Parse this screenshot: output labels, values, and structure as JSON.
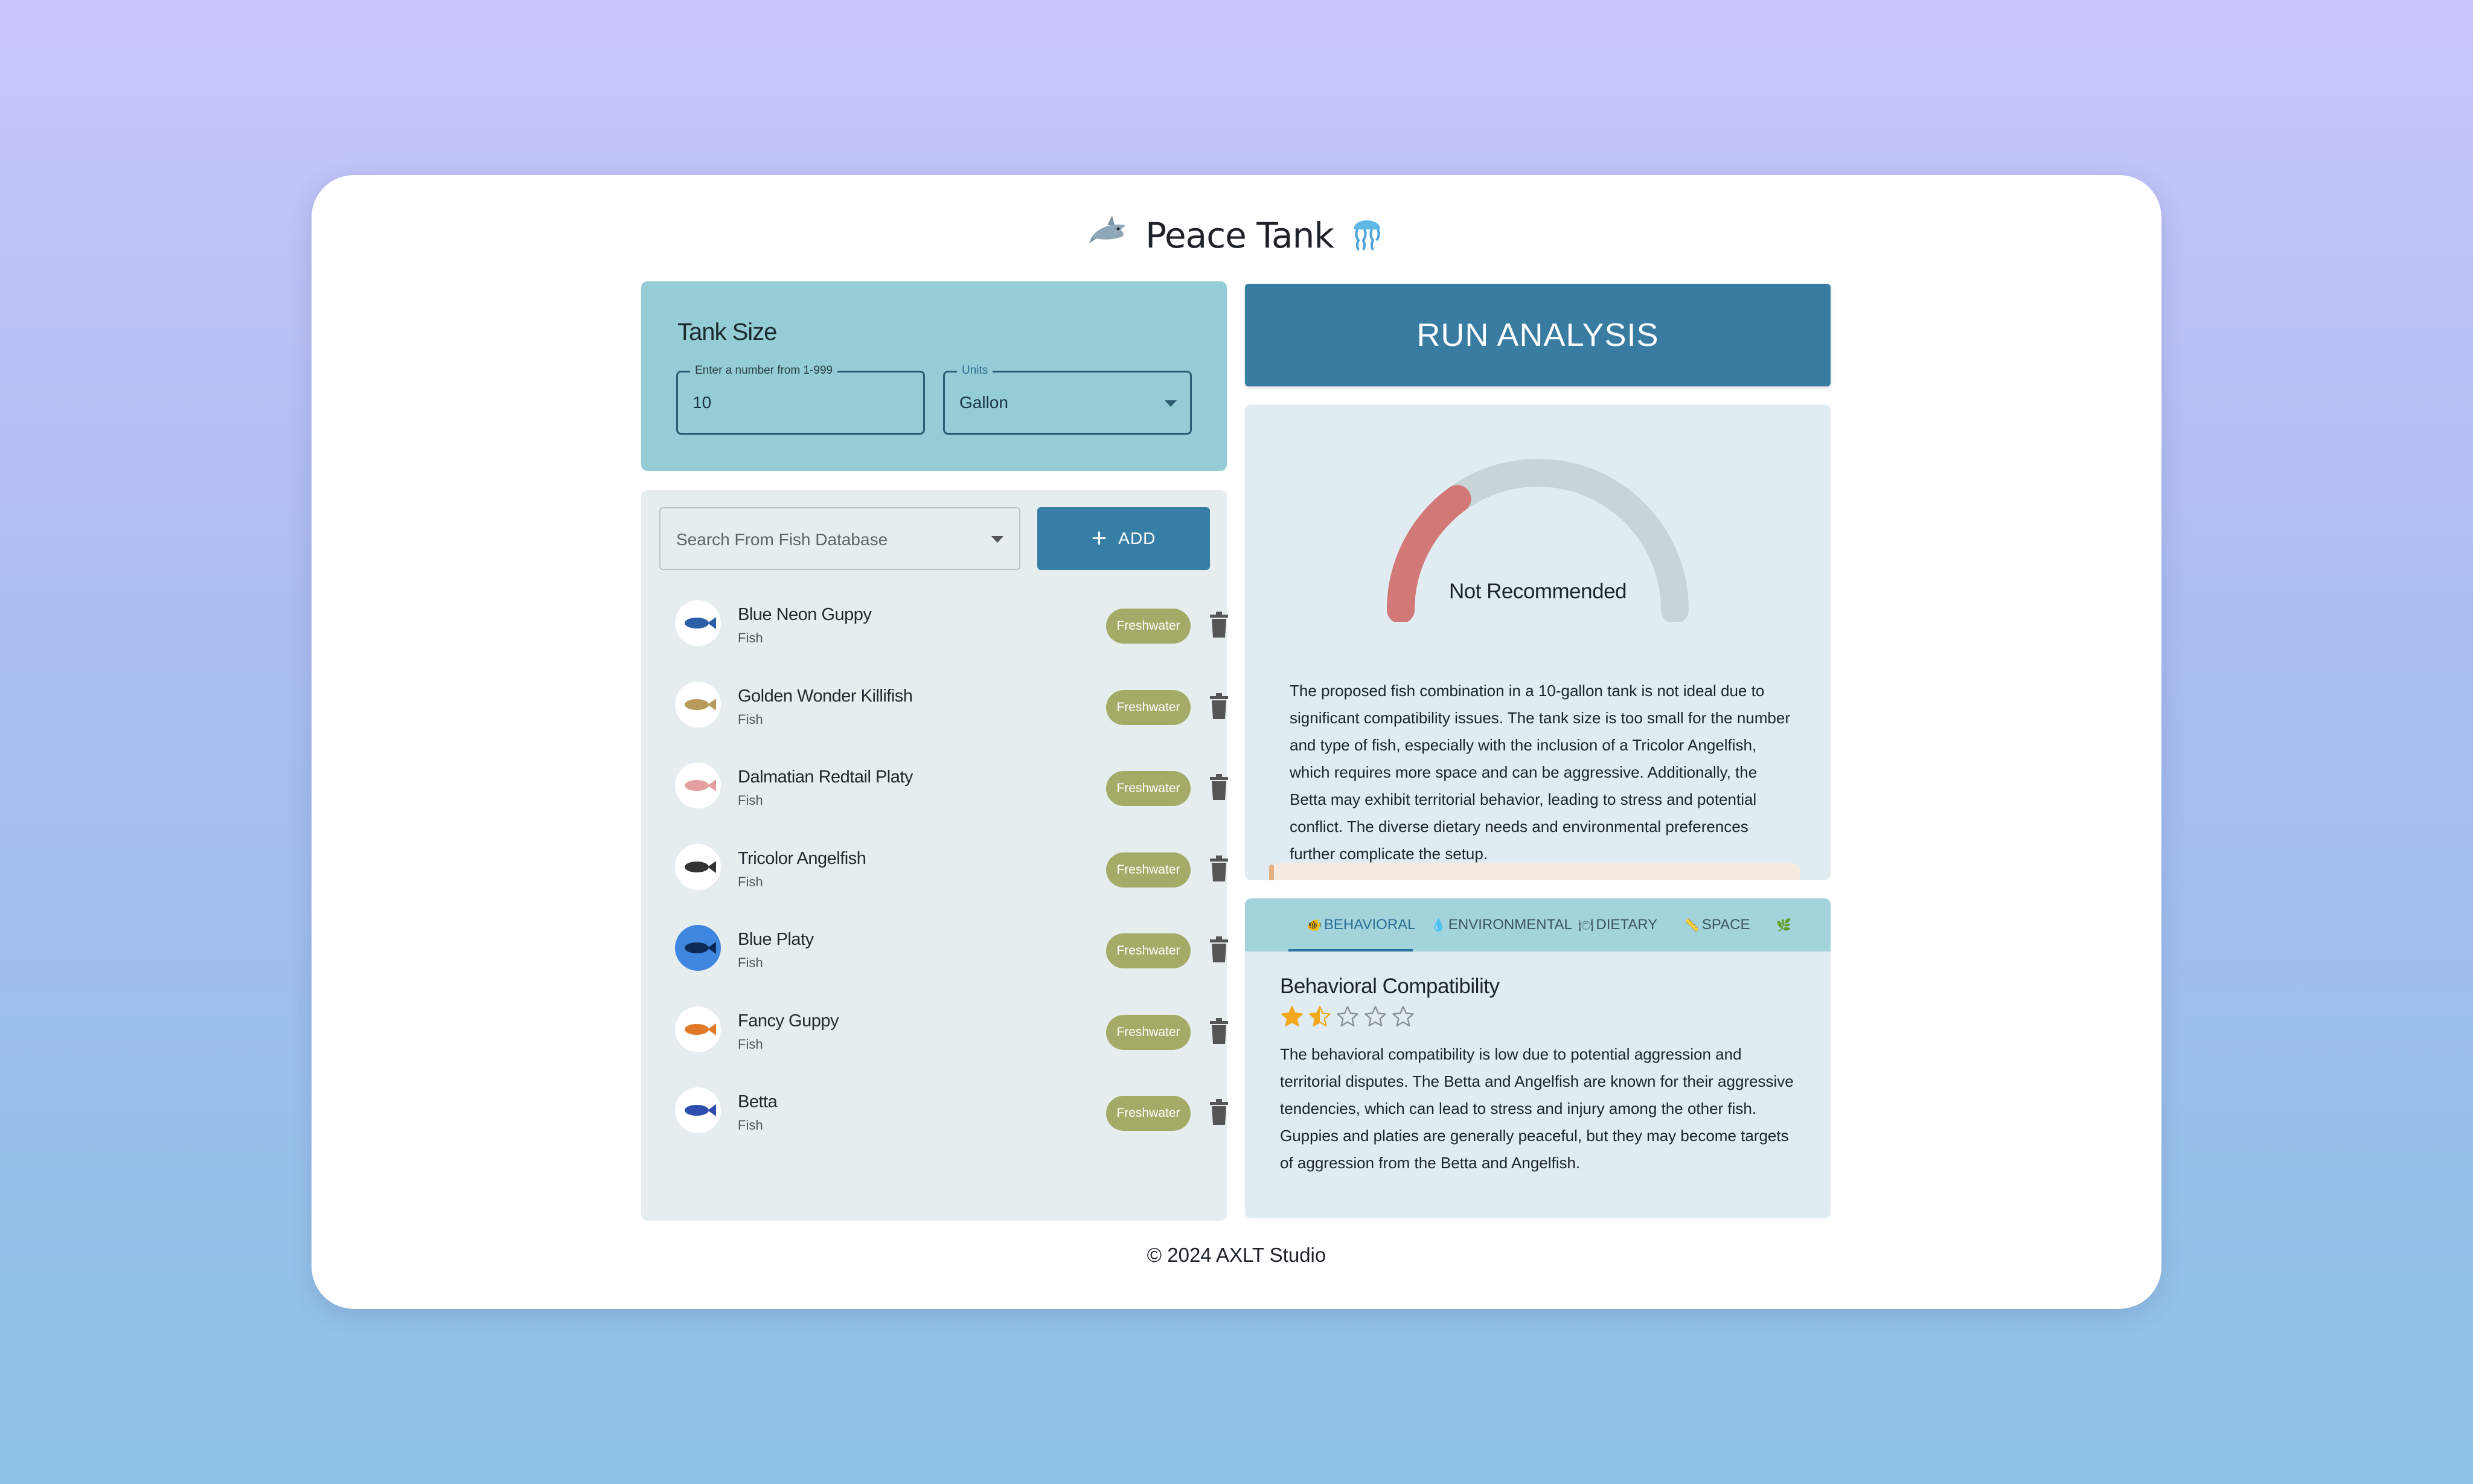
{
  "app": {
    "title": "Peace Tank",
    "icon_left": "shark-icon",
    "icon_right": "jellyfish-icon"
  },
  "tank": {
    "heading": "Tank Size",
    "size_label": "Enter a number from 1-999",
    "size_value": "10",
    "units_label": "Units",
    "units_value": "Gallon"
  },
  "fish_panel": {
    "search_placeholder": "Search From Fish Database",
    "add_label": "ADD",
    "fish": [
      {
        "name": "Blue Neon Guppy",
        "type": "Fish",
        "badge": "Freshwater",
        "color": "#2b5fa8"
      },
      {
        "name": "Golden Wonder Killifish",
        "type": "Fish",
        "badge": "Freshwater",
        "color": "#b89a5a"
      },
      {
        "name": "Dalmatian Redtail Platy",
        "type": "Fish",
        "badge": "Freshwater",
        "color": "#e4a0a0"
      },
      {
        "name": "Tricolor Angelfish",
        "type": "Fish",
        "badge": "Freshwater",
        "color": "#333333"
      },
      {
        "name": "Blue Platy",
        "type": "Fish",
        "badge": "Freshwater",
        "color": "#2d6fd6"
      },
      {
        "name": "Fancy Guppy",
        "type": "Fish",
        "badge": "Freshwater",
        "color": "#e07a2a"
      },
      {
        "name": "Betta",
        "type": "Fish",
        "badge": "Freshwater",
        "color": "#2e4fb0"
      }
    ]
  },
  "analysis": {
    "run_label": "RUN ANALYSIS",
    "gauge_label": "Not Recommended",
    "gauge_fraction": 0.2,
    "gauge_color": "#d27877",
    "summary": "The proposed fish combination in a 10-gallon tank is not ideal due to significant compatibility issues. The tank size is too small for the number and type of fish, especially with the inclusion of a Tricolor Angelfish, which requires more space and can be aggressive. Additionally, the Betta may exhibit territorial behavior, leading to stress and potential conflict. The diverse dietary needs and environmental preferences further complicate the setup."
  },
  "details": {
    "tabs": [
      {
        "label": "BEHAVIORAL",
        "icon": "fish-icon"
      },
      {
        "label": "ENVIRONMENTAL",
        "icon": "droplet-icon"
      },
      {
        "label": "DIETARY",
        "icon": "bowl-icon"
      },
      {
        "label": "SPACE",
        "icon": "ruler-icon"
      },
      {
        "label": "",
        "icon": "leaf-icon"
      }
    ],
    "title": "Behavioral Compatibility",
    "rating": 1.5,
    "rating_max": 5,
    "text": "The behavioral compatibility is low due to potential aggression and territorial disputes. The Betta and Angelfish are known for their aggressive tendencies, which can lead to stress and injury among the other fish. Guppies and platies are generally peaceful, but they may become targets of aggression from the Betta and Angelfish."
  },
  "footer": {
    "text": "© 2024 AXLT Studio"
  }
}
